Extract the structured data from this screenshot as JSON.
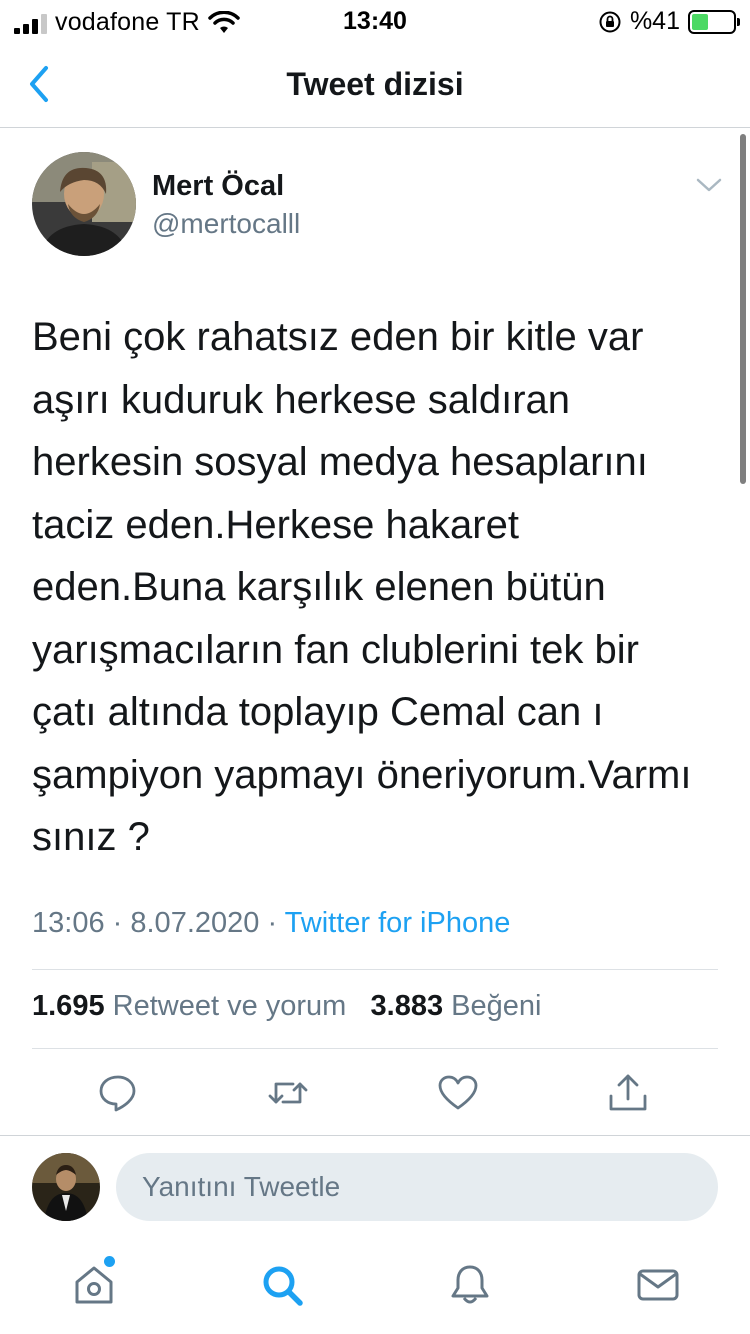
{
  "status_bar": {
    "carrier": "vodafone TR",
    "time": "13:40",
    "battery_percent": "%41",
    "battery_level": 0.41,
    "signal_bars": 3,
    "icons": [
      "signal-icon",
      "wifi-icon",
      "orientation-lock-icon",
      "battery-icon"
    ]
  },
  "nav": {
    "title": "Tweet dizisi",
    "back_icon": "chevron-left-icon"
  },
  "tweet": {
    "author_name": "Mert Öcal",
    "author_handle": "@mertocalll",
    "text": "Beni çok rahatsız eden bir kitle var\naşırı kuduruk herkese saldıran\nherkesin sosyal medya hesaplarını\ntaciz eden.Herkese hakaret\neden.Buna karşılık elenen bütün\nyarışmacıların fan clublerini tek bir\nçatı altında toplayıp Cemal can ı\nşampiyon yapmayı öneriyorum.Varmı\nsınız ?",
    "time": "13:06",
    "separator": "·",
    "date": "8.07.2020",
    "source": "Twitter for iPhone",
    "retweet_count": "1.695",
    "retweet_label": "Retweet ve yorum",
    "like_count": "3.883",
    "like_label": "Beğeni"
  },
  "actions": [
    "reply-icon",
    "retweet-icon",
    "like-icon",
    "share-icon"
  ],
  "reply": {
    "placeholder": "Yanıtını Tweetle"
  },
  "tabs": [
    "home-icon",
    "search-icon",
    "notifications-icon",
    "messages-icon"
  ],
  "colors": {
    "accent": "#1da1f2",
    "text": "#14171a",
    "secondary": "#657786",
    "battery": "#4cd964",
    "reply_field": "#e6ecf0"
  }
}
